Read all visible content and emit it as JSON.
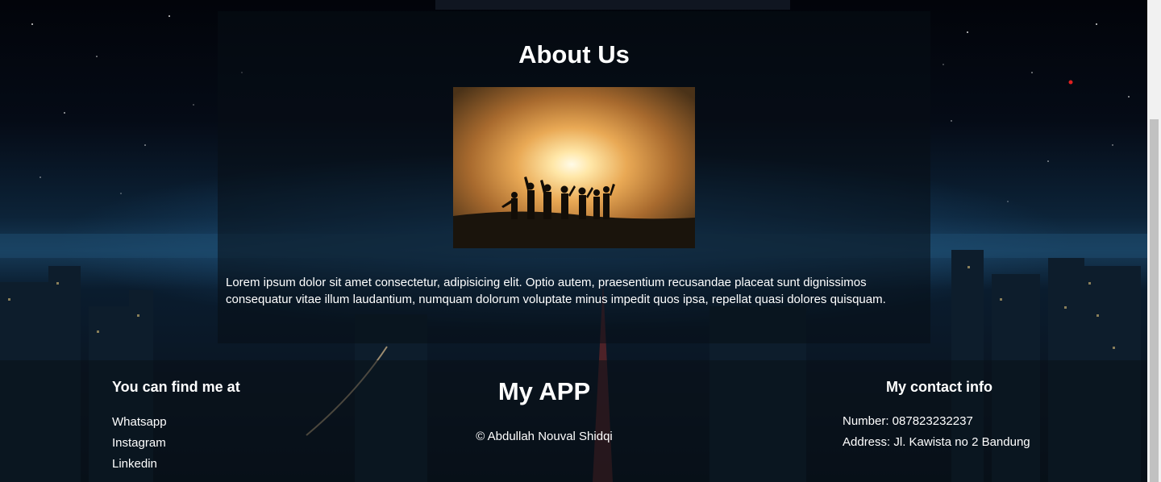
{
  "about": {
    "title": "About Us",
    "text": "Lorem ipsum dolor sit amet consectetur, adipisicing elit. Optio autem, praesentium recusandae placeat sunt dignissimos consequatur vitae illum laudantium, numquam dolorum voluptate minus impedit quos ipsa, repellat quasi dolores quisquam."
  },
  "footer": {
    "find_title": "You can find me at",
    "links": [
      "Whatsapp",
      "Instagram",
      "Linkedin"
    ],
    "app_name": "My APP",
    "copyright": "© Abdullah Nouval Shidqi",
    "contact_title": "My contact info",
    "number": "Number: 087823232237",
    "address": "Address: Jl. Kawista no 2 Bandung"
  }
}
